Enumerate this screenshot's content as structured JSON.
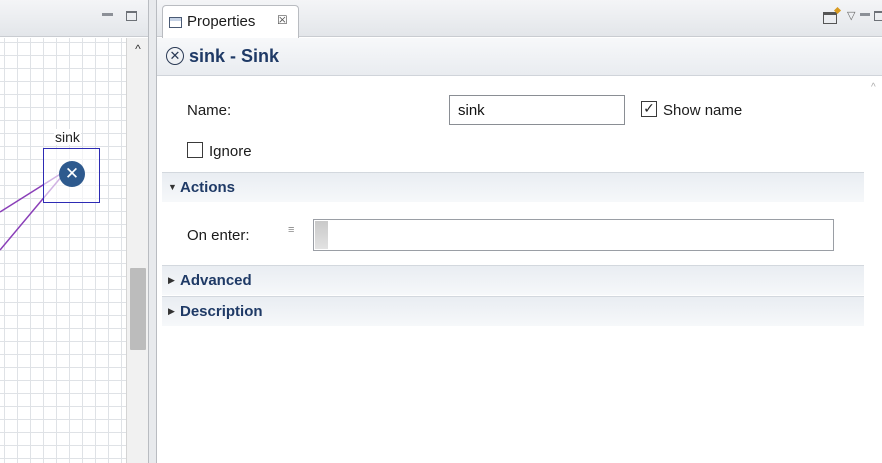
{
  "editor": {
    "node_label": "sink"
  },
  "properties_view": {
    "tab_label": "Properties",
    "tab_close": "☒",
    "title": "sink - Sink",
    "name_label": "Name:",
    "name_value": "sink",
    "show_name_label": "Show name",
    "show_name_checked": true,
    "ignore_label": "Ignore",
    "ignore_checked": false,
    "sections": {
      "actions": {
        "label": "Actions",
        "expanded": true
      },
      "advanced": {
        "label": "Advanced",
        "expanded": false
      },
      "description": {
        "label": "Description",
        "expanded": false
      }
    },
    "on_enter_label": "On enter:",
    "on_enter_value": ""
  },
  "colors": {
    "accent_title": "#1f3a66",
    "node_fill": "#2e5a8e",
    "selection_border": "#2d2bb4",
    "connector": "#8a3fb8"
  },
  "icons": {
    "sink_node": "sink-icon",
    "properties_tab": "properties-icon",
    "pin": "pin-icon",
    "view_menu": "view-menu-icon",
    "minimize": "minimize-icon",
    "maximize": "maximize-icon"
  }
}
